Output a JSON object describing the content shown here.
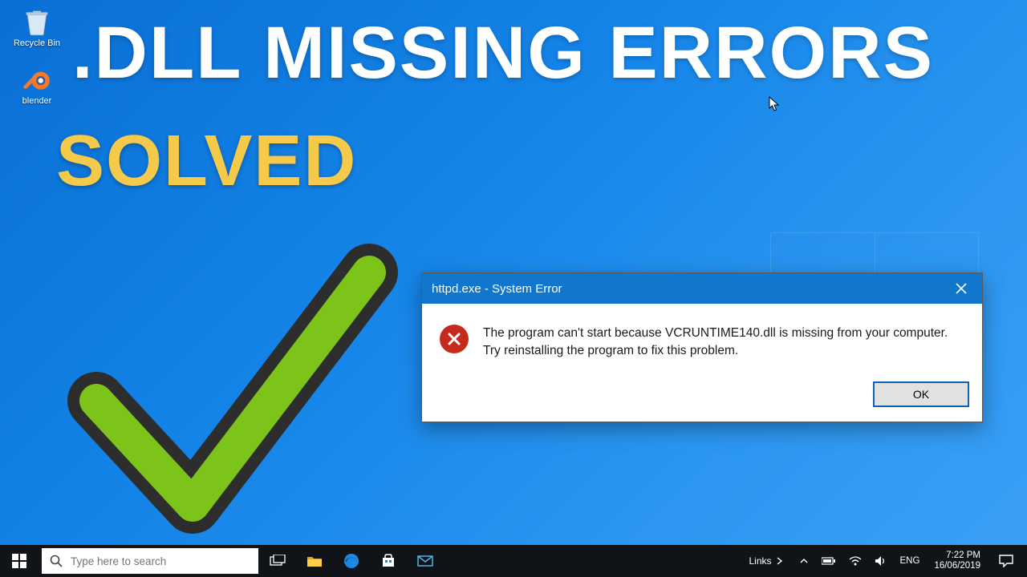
{
  "desktop": {
    "icons": [
      {
        "label": "Recycle Bin"
      },
      {
        "label": "blender"
      }
    ]
  },
  "overlay": {
    "headline1": ".DLL MISSING ERRORS",
    "headline2": "SOLVED"
  },
  "dialog": {
    "title": "httpd.exe - System Error",
    "message": "The program can't start because VCRUNTIME140.dll is missing from your computer. Try reinstalling the program to fix this problem.",
    "ok_label": "OK"
  },
  "taskbar": {
    "search_placeholder": "Type here to search",
    "links_label": "Links",
    "lang": "ENG",
    "time": "7:22 PM",
    "date": "16/06/2019"
  }
}
